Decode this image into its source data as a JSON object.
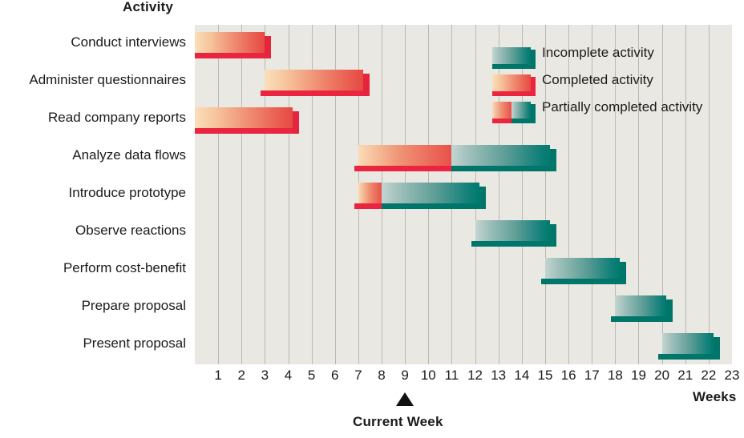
{
  "titles": {
    "activity_axis": "Activity",
    "weeks_axis": "Weeks",
    "current_week": "Current Week"
  },
  "legend": {
    "items": [
      {
        "label": "Incomplete activity",
        "kind": "incomplete",
        "color": "#007a6d"
      },
      {
        "label": "Completed activity",
        "kind": "completed",
        "color": "#e8514a"
      },
      {
        "label": "Partially completed activity",
        "kind": "partial",
        "color": "#e8514a"
      }
    ]
  },
  "colors": {
    "plot_background": "#e9e8e2",
    "gridline": "#b9b8b1",
    "teal_dark": "#007a6d",
    "teal_light": "#c3d5d1",
    "red_dark": "#e8514a",
    "red_light": "#fadfba",
    "red_shadow": "#ea2540",
    "teal_shadow": "#00766a",
    "text": "#1b1b1b"
  },
  "chart_data": {
    "type": "bar",
    "chart_style": "gantt",
    "title": "",
    "xlabel": "Weeks",
    "ylabel": "Activity",
    "xlim": [
      0,
      23
    ],
    "grid": true,
    "legend_position": "top-right",
    "xticks": [
      1,
      2,
      3,
      4,
      5,
      6,
      7,
      8,
      9,
      10,
      11,
      12,
      13,
      14,
      15,
      16,
      17,
      18,
      19,
      20,
      21,
      22,
      23
    ],
    "current_week": 9,
    "categories": [
      "Conduct interviews",
      "Administer questionnaires",
      "Read company reports",
      "Analyze data flows",
      "Introduce prototype",
      "Observe reactions",
      "Perform cost-benefit",
      "Prepare proposal",
      "Present proposal"
    ],
    "tasks": [
      {
        "name": "Conduct interviews",
        "start": 0,
        "end": 3,
        "completed_end": 3,
        "status": "completed"
      },
      {
        "name": "Administer questionnaires",
        "start": 3,
        "end": 7.2,
        "completed_end": 7.2,
        "status": "completed"
      },
      {
        "name": "Read company reports",
        "start": 0,
        "end": 4.2,
        "completed_end": 4.2,
        "status": "completed"
      },
      {
        "name": "Analyze data flows",
        "start": 7,
        "end": 15.2,
        "completed_end": 11,
        "status": "partial"
      },
      {
        "name": "Introduce prototype",
        "start": 7,
        "end": 12.2,
        "completed_end": 8,
        "status": "partial"
      },
      {
        "name": "Observe reactions",
        "start": 12,
        "end": 15.2,
        "completed_end": 12,
        "status": "incomplete"
      },
      {
        "name": "Perform cost-benefit",
        "start": 15,
        "end": 18.2,
        "completed_end": 15,
        "status": "incomplete"
      },
      {
        "name": "Prepare proposal",
        "start": 18,
        "end": 20.2,
        "completed_end": 18,
        "status": "incomplete"
      },
      {
        "name": "Present proposal",
        "start": 20,
        "end": 22.2,
        "completed_end": 20,
        "status": "incomplete"
      }
    ]
  }
}
